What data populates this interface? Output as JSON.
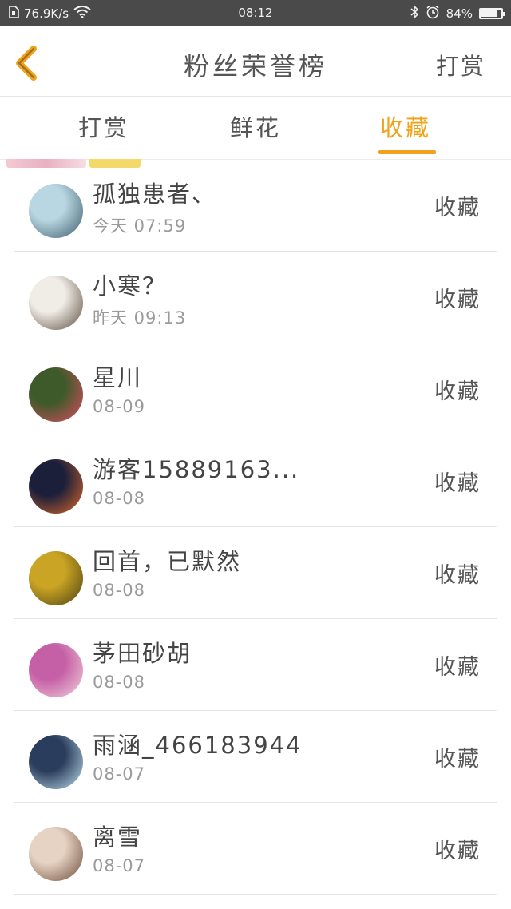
{
  "status_bar": {
    "speed": "76.9K/s",
    "time": "08:12",
    "battery": "84%",
    "battery_level": 0.84,
    "icons": [
      "sim-icon",
      "wifi-icon",
      "bluetooth-icon",
      "alarm-icon",
      "battery-icon"
    ]
  },
  "header": {
    "title": "粉丝荣誉榜",
    "action": "打赏",
    "back_icon": "chevron-left-icon"
  },
  "tabs": [
    {
      "label": "打赏",
      "active": false
    },
    {
      "label": "鲜花",
      "active": false
    },
    {
      "label": "收藏",
      "active": true
    }
  ],
  "colors": {
    "accent": "#f0a21a",
    "status_bar": "#4a4a4a",
    "text": "#444444",
    "muted": "#9a9a9a"
  },
  "list": [
    {
      "name": "孤独患者、",
      "time": "今天 07:59",
      "action": "收藏",
      "avatar_colors": [
        "#b9d7e2",
        "#3b5b6a"
      ]
    },
    {
      "name": "小寒？",
      "time": "昨天 09:13",
      "action": "收藏",
      "avatar_colors": [
        "#f0ece6",
        "#5a4a3c"
      ]
    },
    {
      "name": "星川",
      "time": "08-09",
      "action": "收藏",
      "avatar_colors": [
        "#3e5a2a",
        "#e14b62"
      ]
    },
    {
      "name": "游客15889163...",
      "time": "08-08",
      "action": "收藏",
      "avatar_colors": [
        "#1b1f3a",
        "#e06a2a"
      ]
    },
    {
      "name": "回首，已默然",
      "time": "08-08",
      "action": "收藏",
      "avatar_colors": [
        "#caa424",
        "#4b4014"
      ]
    },
    {
      "name": "茅田砂胡",
      "time": "08-08",
      "action": "收藏",
      "avatar_colors": [
        "#c55fa6",
        "#f2d4dc"
      ]
    },
    {
      "name": "雨涵_466183944",
      "time": "08-07",
      "action": "收藏",
      "avatar_colors": [
        "#2b3d5c",
        "#bfe0ee"
      ]
    },
    {
      "name": "离雪",
      "time": "08-07",
      "action": "收藏",
      "avatar_colors": [
        "#e7d3c3",
        "#6a4a3a"
      ]
    }
  ]
}
